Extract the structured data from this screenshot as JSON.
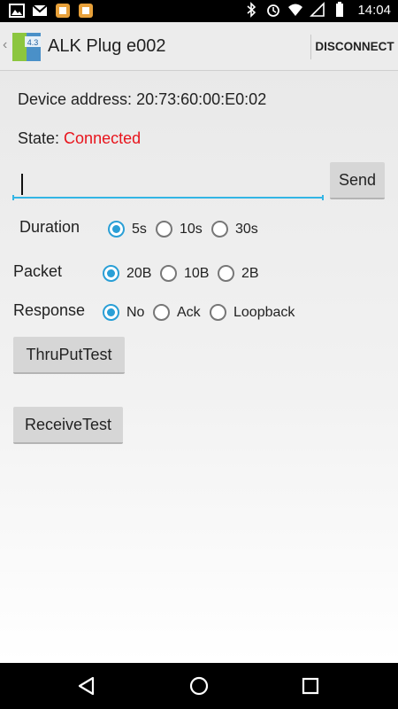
{
  "status_bar": {
    "time": "14:04",
    "left_icons": [
      "image-notification-icon",
      "gmail-icon",
      "app-notification-icon",
      "app-notification-icon"
    ],
    "right_icons": [
      "bluetooth-icon",
      "alarm-icon",
      "wifi-icon",
      "signal-icon",
      "battery-icon"
    ]
  },
  "action_bar": {
    "title": "ALK Plug e002",
    "app_icon_text": "4.3",
    "disconnect_label": "DISCONNECT"
  },
  "device": {
    "address_label": "Device address:",
    "address_value": "20:73:60:00:E0:02",
    "state_label": "State:",
    "state_value": "Connected"
  },
  "colors": {
    "accent": "#33b5e5",
    "connected": "#e8141c"
  },
  "message": {
    "value": "",
    "placeholder": "",
    "send_label": "Send"
  },
  "duration": {
    "label": "Duration",
    "options": [
      "5s",
      "10s",
      "30s"
    ],
    "selected": "5s"
  },
  "packet": {
    "label": "Packet",
    "options": [
      "20B",
      "10B",
      "2B"
    ],
    "selected": "20B"
  },
  "response": {
    "label": "Response",
    "options": [
      "No",
      "Ack",
      "Loopback"
    ],
    "selected": "No"
  },
  "buttons": {
    "thruput": "ThruPutTest",
    "receive": "ReceiveTest"
  },
  "nav": {
    "items": [
      "back-icon",
      "home-icon",
      "recents-icon"
    ]
  }
}
